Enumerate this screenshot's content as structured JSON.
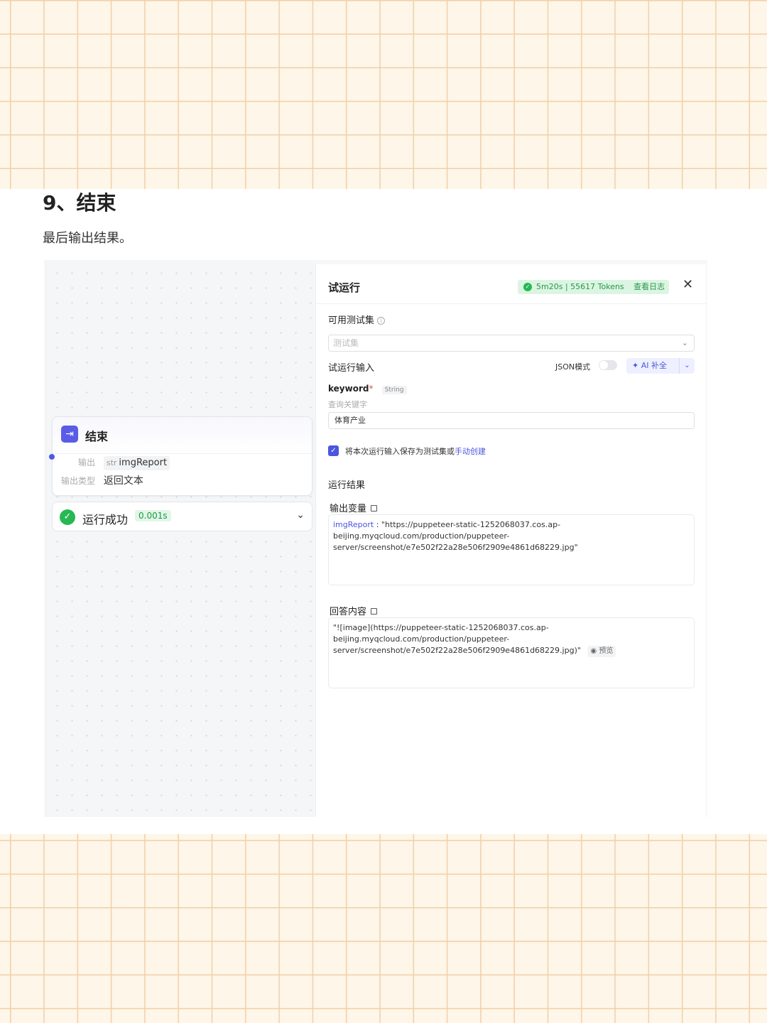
{
  "article": {
    "heading": "9、结束",
    "paragraph": "最后输出结果。"
  },
  "node": {
    "title": "结束",
    "output_label": "输出",
    "output_type_tag": "str",
    "output_name": "imgReport",
    "output_kind_label": "输出类型",
    "output_kind_value": "返回文本"
  },
  "run_status": {
    "text": "运行成功",
    "time": "0.001s"
  },
  "panel": {
    "title": "试运行",
    "badge_stats": "5m20s | 55617 Tokens",
    "badge_log": "查看日志",
    "test_set_label": "可用测试集",
    "test_set_placeholder": "测试集",
    "run_input_label": "试运行输入",
    "json_mode_label": "JSON模式",
    "ai_fill_label": "AI 补全",
    "param_name": "keyword",
    "param_required": "*",
    "param_type": "String",
    "param_desc": "查询关键字",
    "param_value": "体育产业",
    "save_checkbox_text": "将本次运行输入保存为测试集或",
    "save_checkbox_link": "手动创建",
    "result_label": "运行结果",
    "output_vars_label": "输出变量",
    "output_var_key": "imgReport",
    "output_var_value": "\"https://puppeteer-static-1252068037.cos.ap-beijing.myqcloud.com/production/puppeteer-server/screenshot/e7e502f22a28e506f2909e4861d68229.jpg\"",
    "answer_label": "回答内容",
    "answer_value": "\"![image](https://puppeteer-static-1252068037.cos.ap-beijing.myqcloud.com/production/puppeteer-server/screenshot/e7e502f22a28e506f2909e4861d68229.jpg)\"",
    "preview_label": "预览"
  },
  "colors": {
    "accent": "#4b56e0",
    "success": "#27b854",
    "grid_line": "#f3cfa6"
  }
}
